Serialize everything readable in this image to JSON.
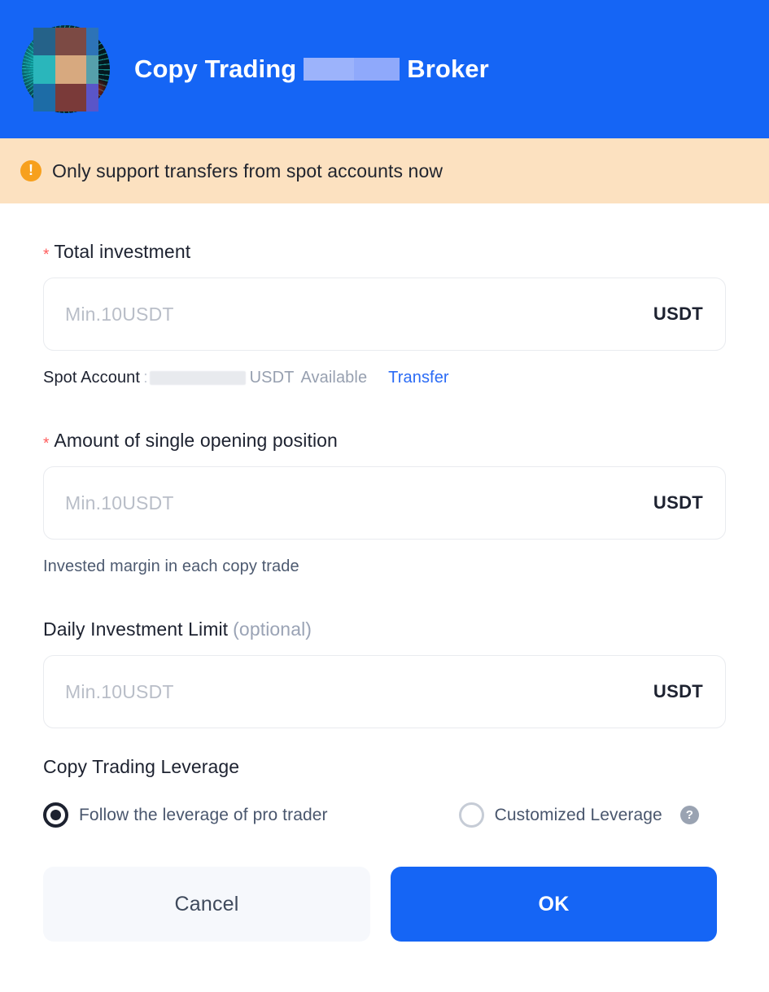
{
  "header": {
    "title_before": "Copy Trading",
    "title_after": "Broker",
    "redaction_colors": [
      "#9cb3fb",
      "#8fa9fb"
    ],
    "background_color": "#1565f5",
    "avatar_name": "pro-trader-avatar",
    "avatar_censor_colors": [
      "#256289",
      "#7c4a44",
      "#2d73b7",
      "#2ab6bb",
      "#d7a97f",
      "#56a0ab",
      "#1d6ca6",
      "#7a3a39",
      "#5a55c8"
    ]
  },
  "banner": {
    "icon": "warning-exclamation-icon",
    "text": "Only support transfers from spot accounts now",
    "background_color": "#fce1c0",
    "icon_color": "#f7a01d"
  },
  "form": {
    "total_investment": {
      "required_marker": "*",
      "label": "Total investment",
      "placeholder": "Min.10USDT",
      "value": "",
      "suffix": "USDT"
    },
    "spot_account": {
      "label": "Spot Account",
      "colon": ":",
      "balance_redacted": true,
      "unit": "USDT",
      "available_text": "Available",
      "transfer_link": "Transfer",
      "link_color": "#2a6bf5"
    },
    "single_opening": {
      "required_marker": "*",
      "label": "Amount of single opening position",
      "placeholder": "Min.10USDT",
      "value": "",
      "suffix": "USDT",
      "helper": "Invested margin in each copy trade"
    },
    "daily_limit": {
      "label": "Daily Investment Limit",
      "optional": "(optional)",
      "placeholder": "Min.10USDT",
      "value": "",
      "suffix": "USDT"
    },
    "leverage": {
      "section_title": "Copy Trading Leverage",
      "options": [
        {
          "label": "Follow the leverage of pro trader",
          "selected": true,
          "help": false
        },
        {
          "label": "Customized Leverage",
          "selected": false,
          "help": true,
          "help_glyph": "?"
        }
      ]
    }
  },
  "footer": {
    "cancel_label": "Cancel",
    "ok_label": "OK",
    "ok_color": "#1565f5",
    "cancel_bg": "#f6f8fc"
  }
}
